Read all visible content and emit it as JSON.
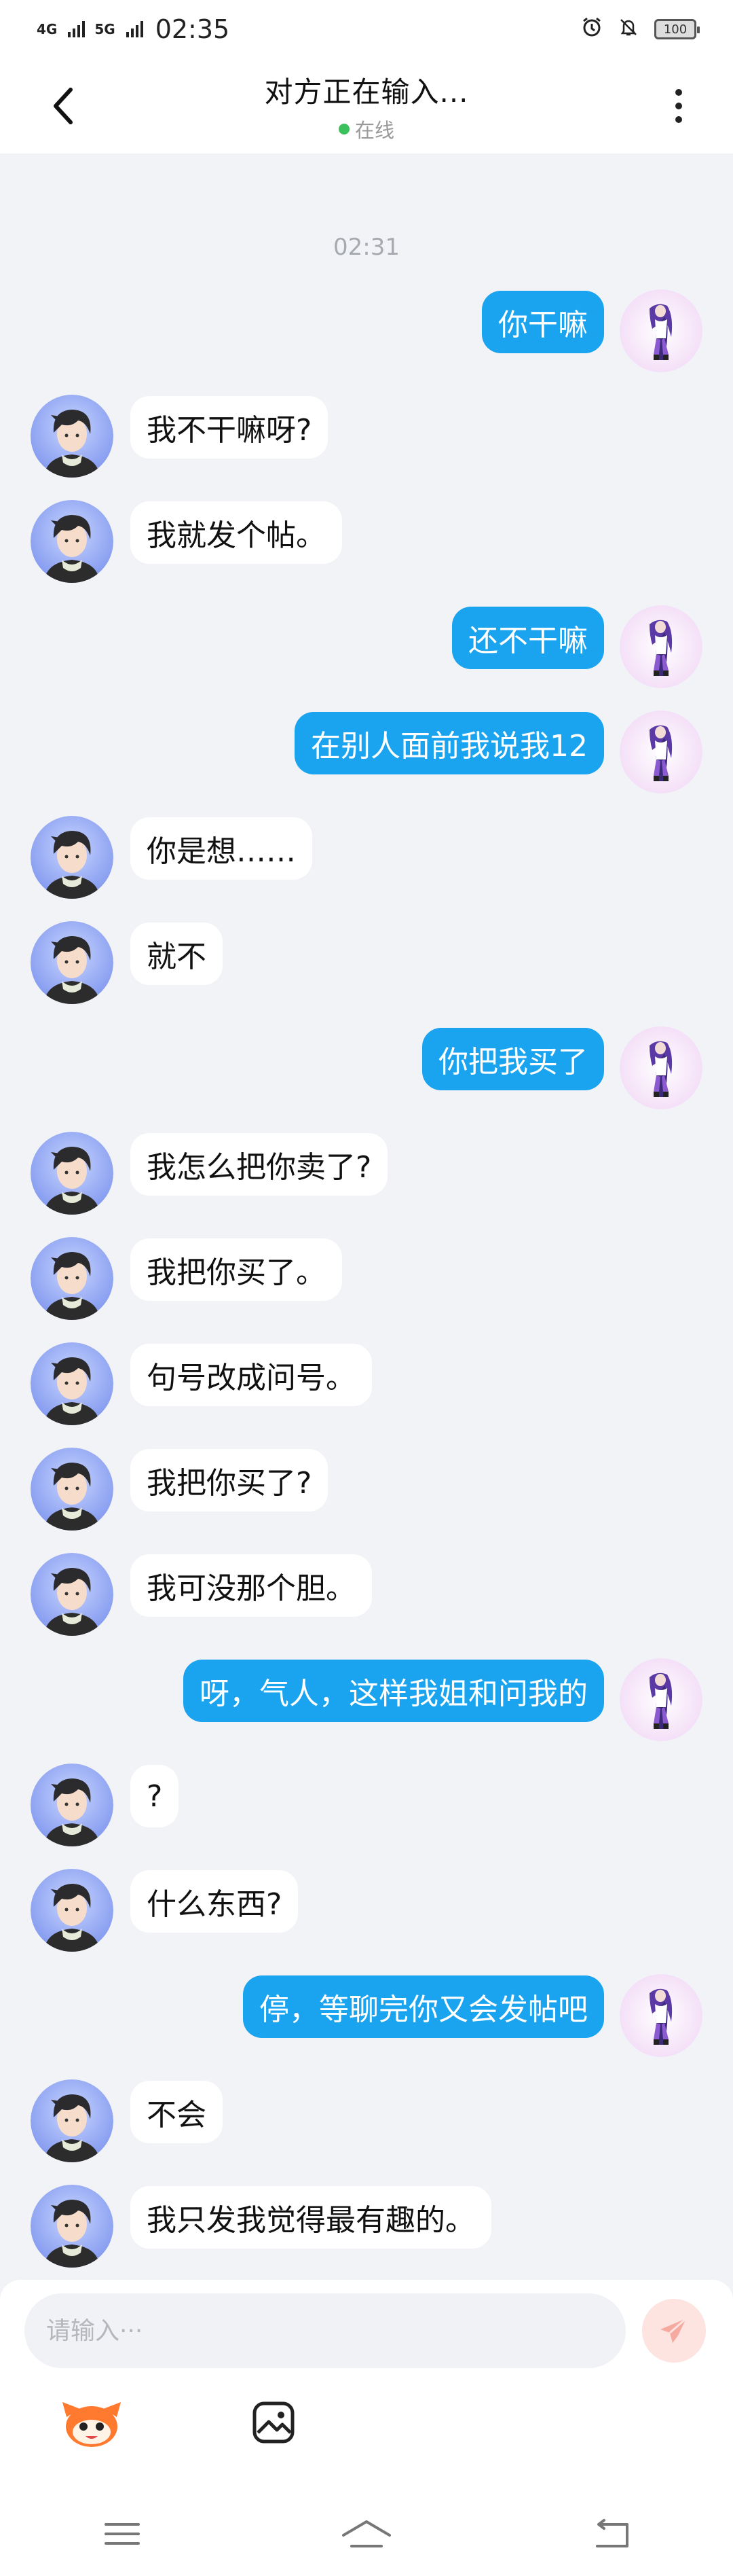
{
  "status_bar": {
    "net1": "4G",
    "net2": "5G",
    "time": "02:35",
    "battery": "100"
  },
  "header": {
    "title": "对方正在输入...",
    "status": "在线",
    "status_color": "#3bc15b"
  },
  "chat": {
    "timestamp": "02:31",
    "messages": [
      {
        "side": "right",
        "text": "你干嘛"
      },
      {
        "side": "left",
        "text": "我不干嘛呀?"
      },
      {
        "side": "left",
        "text": "我就发个帖。"
      },
      {
        "side": "right",
        "text": "还不干嘛"
      },
      {
        "side": "right",
        "text": "在别人面前我说我12"
      },
      {
        "side": "left",
        "text": "你是想……"
      },
      {
        "side": "left",
        "text": "就不"
      },
      {
        "side": "right",
        "text": "你把我买了"
      },
      {
        "side": "left",
        "text": "我怎么把你卖了?"
      },
      {
        "side": "left",
        "text": "我把你买了。"
      },
      {
        "side": "left",
        "text": "句号改成问号。"
      },
      {
        "side": "left",
        "text": "我把你买了?"
      },
      {
        "side": "left",
        "text": "我可没那个胆。"
      },
      {
        "side": "right",
        "text": "呀，气人，这样我姐和问我的"
      },
      {
        "side": "left",
        "text": "?"
      },
      {
        "side": "left",
        "text": "什么东西?"
      },
      {
        "side": "right",
        "text": "停，等聊完你又会发帖吧"
      },
      {
        "side": "left",
        "text": "不会"
      },
      {
        "side": "left",
        "text": "我只发我觉得最有趣的。"
      }
    ]
  },
  "input": {
    "placeholder": "请输入···"
  },
  "colors": {
    "outgoing_bubble": "#1aa3ef",
    "incoming_bubble": "#ffffff",
    "background": "#f2f3f7",
    "send_button": "#fde4e1"
  },
  "icons": {
    "back": "chevron-left-icon",
    "more": "more-vertical-icon",
    "send": "send-icon",
    "emoji": "mascot-emoji-icon",
    "image": "image-icon",
    "nav_menu": "menu-icon",
    "nav_home": "home-icon",
    "nav_back": "back-arrow-icon"
  }
}
